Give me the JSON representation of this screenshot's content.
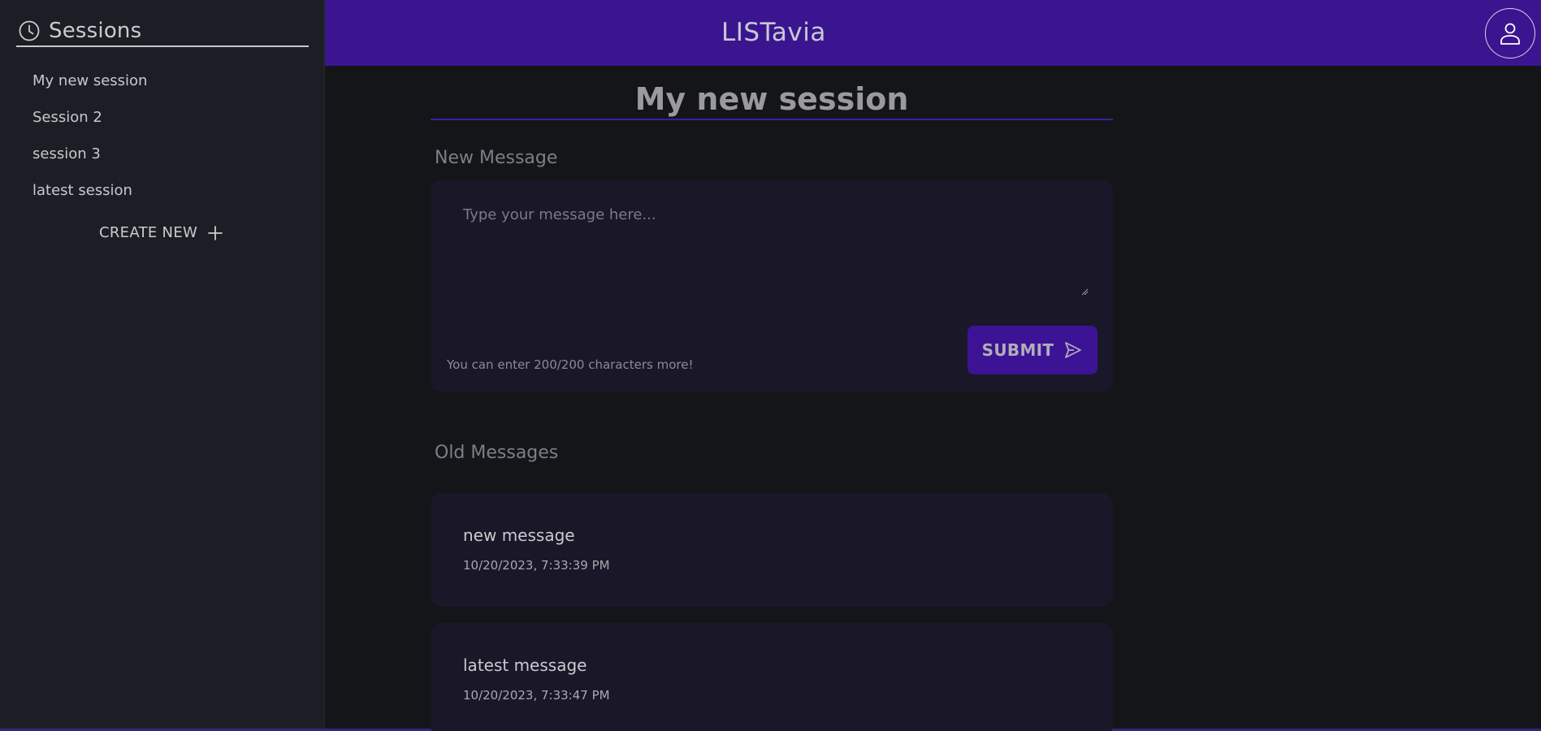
{
  "sidebar": {
    "title": "Sessions",
    "icon": "clock-icon",
    "items": [
      {
        "label": "My new session"
      },
      {
        "label": "Session 2"
      },
      {
        "label": "session 3"
      },
      {
        "label": "latest session"
      }
    ],
    "create_new_label": "CREATE NEW"
  },
  "header": {
    "brand": "LISTavia",
    "accent_color": "#3b1590",
    "avatar_icon": "user-icon"
  },
  "main": {
    "page_title": "My new session",
    "new_message": {
      "section_label": "New Message",
      "placeholder": "Type your message here...",
      "value": "",
      "char_count_text": "You can enter 200/200 characters more!",
      "submit_label": "SUBMIT"
    },
    "old_messages": {
      "section_label": "Old Messages",
      "items": [
        {
          "text": "new message",
          "timestamp": "10/20/2023, 7:33:39 PM"
        },
        {
          "text": "latest message",
          "timestamp": "10/20/2023, 7:33:47 PM"
        }
      ]
    }
  }
}
